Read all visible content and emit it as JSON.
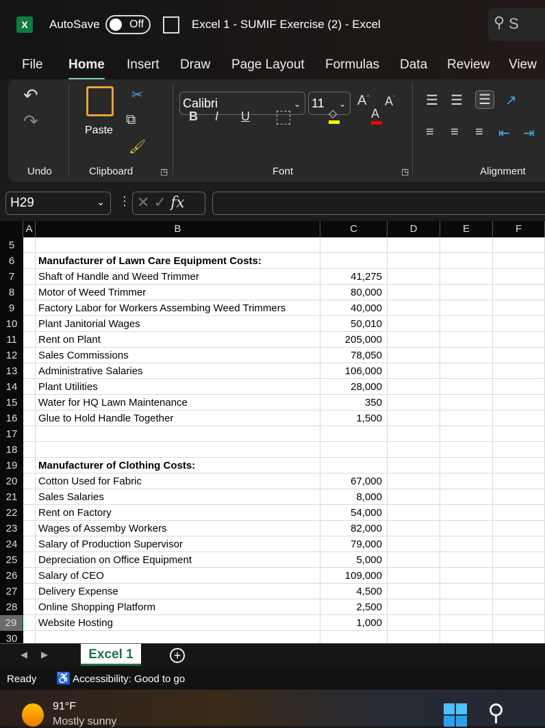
{
  "titlebar": {
    "autosave": "AutoSave",
    "toggle": "Off",
    "title": "Excel 1 - SUMIF Exercise (2)  -  Excel",
    "search": "S"
  },
  "tabs": [
    "File",
    "Home",
    "Insert",
    "Draw",
    "Page Layout",
    "Formulas",
    "Data",
    "Review",
    "View"
  ],
  "ribbon": {
    "undo": "Undo",
    "clipboard": "Clipboard",
    "paste": "Paste",
    "font_group": "Font",
    "font": "Calibri",
    "size": "11",
    "alignment": "Alignment",
    "bold": "B",
    "italic": "I",
    "underline": "U"
  },
  "formula_bar": {
    "name_box": "H29",
    "fx": "fx",
    "value": ""
  },
  "columns": [
    "A",
    "B",
    "C",
    "D",
    "E",
    "F"
  ],
  "rows": [
    {
      "n": "5",
      "b": "",
      "c": ""
    },
    {
      "n": "6",
      "b": "Manufacturer of Lawn Care Equipment Costs:",
      "c": "",
      "bold": true
    },
    {
      "n": "7",
      "b": "Shaft of Handle and Weed Trimmer",
      "c": "41,275"
    },
    {
      "n": "8",
      "b": "Motor of Weed Trimmer",
      "c": "80,000"
    },
    {
      "n": "9",
      "b": "Factory Labor for Workers Assembing Weed Trimmers",
      "c": "40,000"
    },
    {
      "n": "10",
      "b": "Plant Janitorial Wages",
      "c": "50,010"
    },
    {
      "n": "11",
      "b": "Rent on Plant",
      "c": "205,000"
    },
    {
      "n": "12",
      "b": "Sales Commissions",
      "c": "78,050"
    },
    {
      "n": "13",
      "b": "Administrative Salaries",
      "c": "106,000"
    },
    {
      "n": "14",
      "b": "Plant Utilities",
      "c": "28,000"
    },
    {
      "n": "15",
      "b": "Water for HQ Lawn Maintenance",
      "c": "350"
    },
    {
      "n": "16",
      "b": "Glue to Hold Handle Together",
      "c": "1,500"
    },
    {
      "n": "17",
      "b": "",
      "c": ""
    },
    {
      "n": "18",
      "b": "",
      "c": ""
    },
    {
      "n": "19",
      "b": "Manufacturer of Clothing Costs:",
      "c": "",
      "bold": true
    },
    {
      "n": "20",
      "b": "Cotton Used for Fabric",
      "c": "67,000"
    },
    {
      "n": "21",
      "b": "Sales Salaries",
      "c": "8,000"
    },
    {
      "n": "22",
      "b": "Rent on Factory",
      "c": "54,000"
    },
    {
      "n": "23",
      "b": "Wages of Assemby Workers",
      "c": "82,000"
    },
    {
      "n": "24",
      "b": "Salary of Production Supervisor",
      "c": "79,000"
    },
    {
      "n": "25",
      "b": "Depreciation on Office Equipment",
      "c": "5,000"
    },
    {
      "n": "26",
      "b": "Salary of CEO",
      "c": "109,000"
    },
    {
      "n": "27",
      "b": "Delivery Expense",
      "c": "4,500"
    },
    {
      "n": "28",
      "b": "Online Shopping Platform",
      "c": "2,500"
    },
    {
      "n": "29",
      "b": "Website Hosting",
      "c": "1,000",
      "selected": true
    },
    {
      "n": "30",
      "b": "",
      "c": ""
    }
  ],
  "sheet": {
    "tab": "Excel 1"
  },
  "status": {
    "ready": "Ready",
    "accessibility": "Accessibility: Good to go"
  },
  "taskbar": {
    "temp": "91°F",
    "weather": "Mostly sunny"
  }
}
